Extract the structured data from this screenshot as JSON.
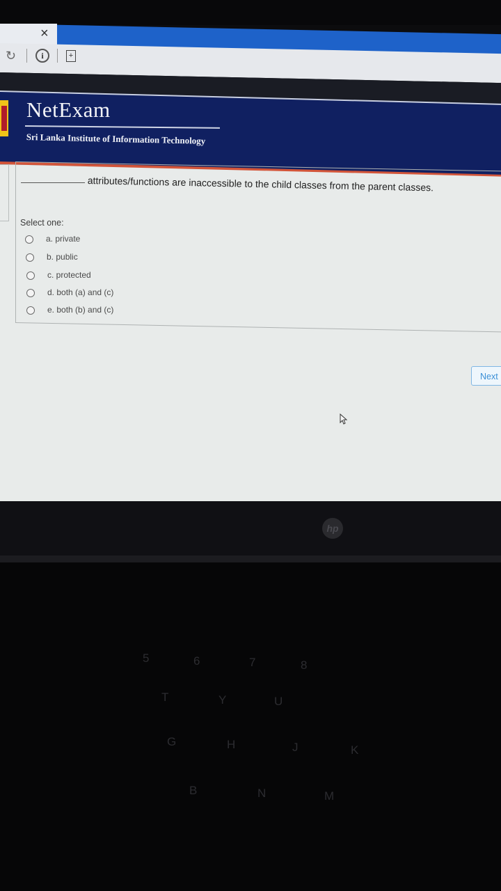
{
  "browser": {
    "tab_close_glyph": "×",
    "refresh_glyph": "↻",
    "info_glyph": "i",
    "page_glyph": "+"
  },
  "header": {
    "brand": "NetExam",
    "institute": "Sri Lanka Institute of Information Technology"
  },
  "question": {
    "text": "attributes/functions are inaccessible to the child classes from the parent classes.",
    "select_label": "Select one:",
    "options": [
      {
        "label": "a. private",
        "selected": false
      },
      {
        "label": "b. public",
        "selected": false
      },
      {
        "label": "c. protected",
        "selected": false
      },
      {
        "label": "d. both (a) and (c)",
        "selected": false
      },
      {
        "label": "e. both (b) and (c)",
        "selected": false
      }
    ]
  },
  "navigation": {
    "next_label": "Next"
  },
  "laptop": {
    "logo_text": "hp",
    "keys": [
      "5",
      "6",
      "7",
      "8",
      "T",
      "Y",
      "U",
      "G",
      "H",
      "J",
      "K",
      "B",
      "N",
      "M"
    ]
  }
}
